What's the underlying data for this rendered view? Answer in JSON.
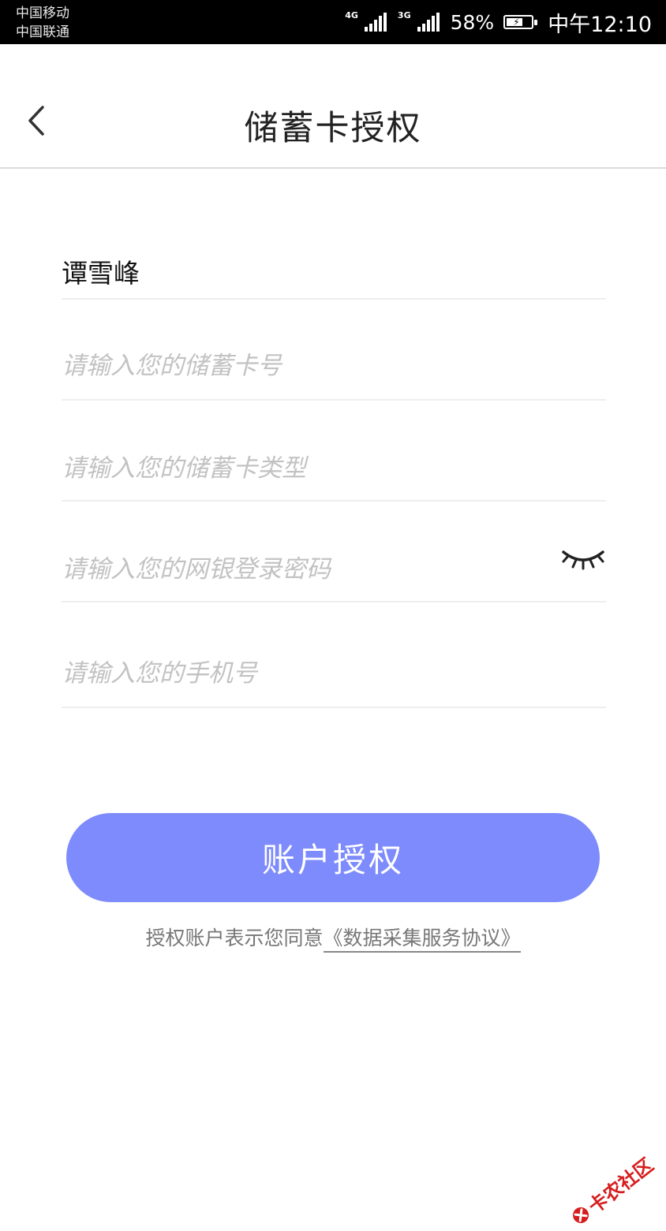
{
  "status_bar": {
    "carrier_1": "中国移动",
    "carrier_2": "中国联通",
    "net_1": "4G",
    "net_2": "3G",
    "battery": "58%",
    "time": "中午12:10"
  },
  "header": {
    "title": "储蓄卡授权",
    "back_icon": "chevron-left-icon"
  },
  "form": {
    "name_value": "谭雪峰",
    "card_number_placeholder": "请输入您的储蓄卡号",
    "card_type_placeholder": "请输入您的储蓄卡类型",
    "password_placeholder": "请输入您的网银登录密码",
    "phone_placeholder": "请输入您的手机号",
    "eye_icon": "eye-closed-icon"
  },
  "actions": {
    "submit_label": "账户授权",
    "agreement_prefix": "授权账户表示您同意",
    "agreement_link": "《数据采集服务协议》"
  },
  "watermark": {
    "text": "卡农社区"
  },
  "colors": {
    "button": "#7d8bfc",
    "placeholder": "#c2c2c2",
    "divider": "#eeeeee",
    "watermark": "#d61e1e"
  }
}
